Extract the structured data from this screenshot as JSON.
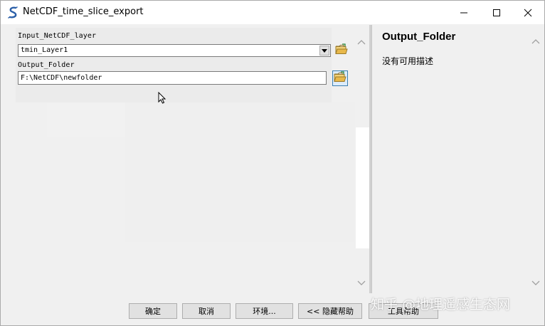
{
  "window": {
    "title": "NetCDF_time_slice_export"
  },
  "params": {
    "input_label": "Input_NetCDF_layer",
    "input_value": "tmin_Layer1",
    "output_label": "Output_Folder",
    "output_value": "F:\\NetCDF\\newfolder"
  },
  "help": {
    "title": "Output_Folder",
    "description": "没有可用描述"
  },
  "buttons": {
    "ok": "确定",
    "cancel": "取消",
    "environments": "环境...",
    "hide_help": "<< 隐藏帮助",
    "tool_help": "工具帮助"
  },
  "watermark": "知乎 @地理遥感生态网",
  "icons": {
    "app": "python-script-icon",
    "folder": "open-folder-icon"
  },
  "colors": {
    "folder_yellow": "#e8b84a",
    "selected_border": "#3c7fb1"
  }
}
